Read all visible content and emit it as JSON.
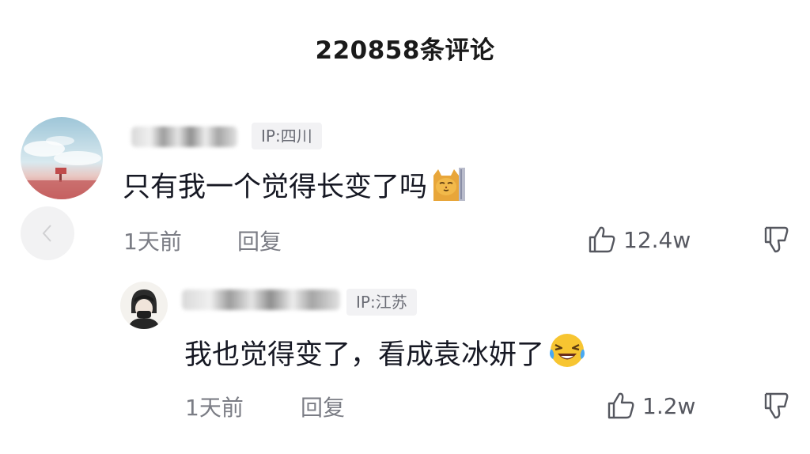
{
  "header": {
    "title": "220858条评论"
  },
  "comments": [
    {
      "ip": "IP:四川",
      "text": "只有我一个觉得长变了吗",
      "emoji": "cat-face-icon",
      "time": "1天前",
      "reply_label": "回复",
      "likes": "12.4w"
    },
    {
      "ip": "IP:江苏",
      "text": "我也觉得变了，看成袁冰妍了",
      "emoji": "laughing-tears-icon",
      "time": "1天前",
      "reply_label": "回复",
      "likes": "1.2w"
    }
  ]
}
